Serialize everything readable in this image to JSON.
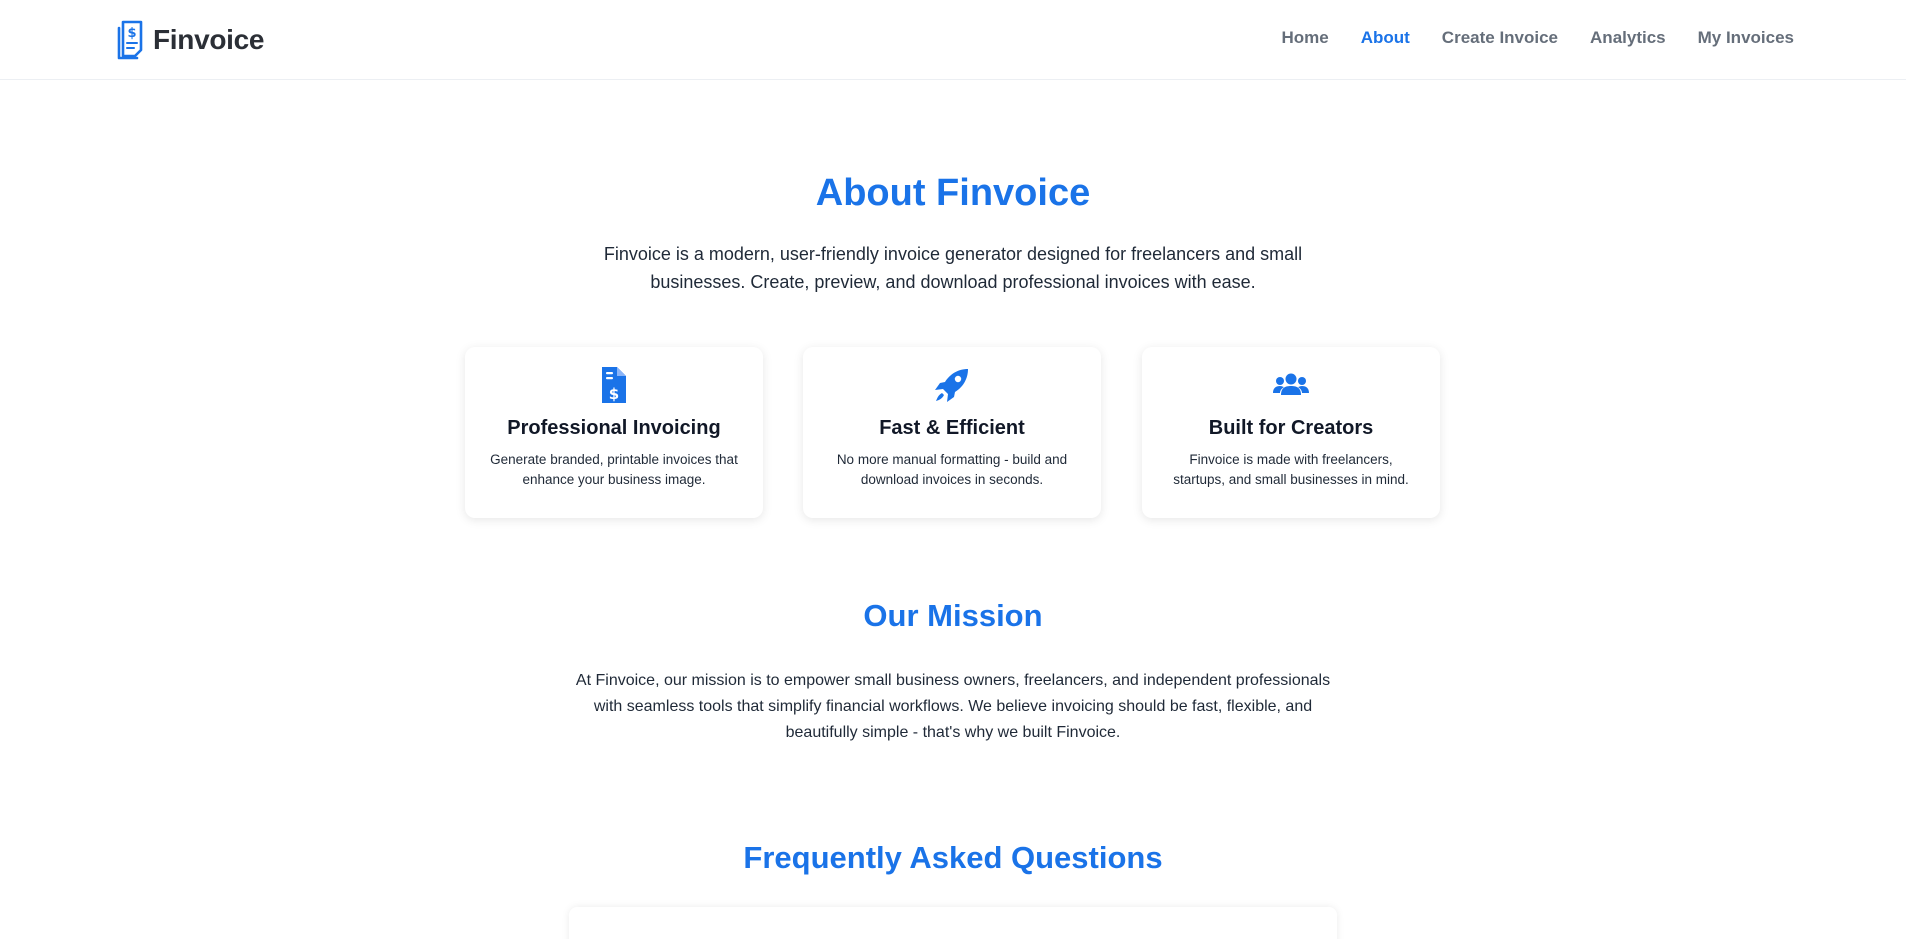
{
  "brand": {
    "name": "Finvoice",
    "logo_icon": "invoice-dollar-icon",
    "logo_color": "#1a73e8"
  },
  "nav": {
    "items": [
      {
        "label": "Home",
        "active": false
      },
      {
        "label": "About",
        "active": true
      },
      {
        "label": "Create Invoice",
        "active": false
      },
      {
        "label": "Analytics",
        "active": false
      },
      {
        "label": "My Invoices",
        "active": false
      }
    ],
    "active_color": "#1a73e8"
  },
  "about": {
    "title": "About Finvoice",
    "intro": "Finvoice is a modern, user-friendly invoice generator designed for freelancers and small businesses. Create, preview, and download professional invoices with ease."
  },
  "features": [
    {
      "icon": "file-invoice-dollar-icon",
      "title": "Professional Invoicing",
      "description": "Generate branded, printable invoices that enhance your business image."
    },
    {
      "icon": "rocket-icon",
      "title": "Fast & Efficient",
      "description": "No more manual formatting - build and download invoices in seconds."
    },
    {
      "icon": "users-icon",
      "title": "Built for Creators",
      "description": "Finvoice is made with freelancers, startups, and small businesses in mind."
    }
  ],
  "mission": {
    "title": "Our Mission",
    "text": "At Finvoice, our mission is to empower small business owners, freelancers, and independent professionals with seamless tools that simplify financial workflows. We believe invoicing should be fast, flexible, and beautifully simple - that's why we built Finvoice."
  },
  "faq": {
    "title": "Frequently Asked Questions"
  },
  "colors": {
    "accent": "#1a73e8",
    "text": "#1f2937",
    "nav_text": "#4b5563"
  }
}
